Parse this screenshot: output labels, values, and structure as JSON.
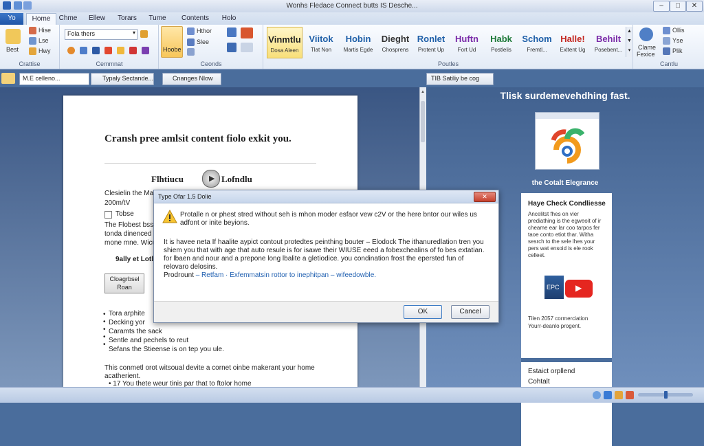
{
  "app": {
    "window_title": "Wonhs Fledace Connect butts IS Desche...",
    "colors": {
      "accent": "#1f55a8",
      "ribbon": "#e3ebf6",
      "doc_bg": "#3a5683"
    }
  },
  "tabs": [
    {
      "label": "Yo"
    },
    {
      "label": "Home"
    },
    {
      "label": "Chme"
    },
    {
      "label": "Ellew"
    },
    {
      "label": "Torars"
    },
    {
      "label": "Tume"
    },
    {
      "label": "Contents"
    },
    {
      "label": "Holo"
    }
  ],
  "ribbon": {
    "clipboard": {
      "group_label": "Crattise",
      "big_label": "Best",
      "item1": "Hise",
      "item2": "Lse",
      "item3": "Hwy"
    },
    "font": {
      "group_label": "Cemmnat",
      "font_value": "Fola thers"
    },
    "paragraph": {
      "group_label": "Ceonds",
      "big_label": "Hoobe",
      "item1": "Hthor",
      "item2": "Slee"
    },
    "styles": {
      "group_label": "Poutles",
      "items": [
        {
          "big": "Vinmtlu",
          "sm": "Dosa Aleen",
          "color": "#1c2a3a"
        },
        {
          "big": "Viitok",
          "sm": "Tlat Non",
          "color": "#1e5fa8"
        },
        {
          "big": "Hobin",
          "sm": "Martis Egde",
          "color": "#1e5fa8"
        },
        {
          "big": "Dieght",
          "sm": "Chosprens",
          "color": "#333333"
        },
        {
          "big": "Ronlet",
          "sm": "Protent Up",
          "color": "#1e5fa8"
        },
        {
          "big": "Huftn",
          "sm": "Fort Ud",
          "color": "#7a2aa8"
        },
        {
          "big": "Habk",
          "sm": "Postlelis",
          "color": "#1f7a3a"
        },
        {
          "big": "Schom",
          "sm": "Fremtl...",
          "color": "#1e5fa8"
        },
        {
          "big": "Halle!",
          "sm": "Exltent Ug",
          "color": "#c4261f"
        },
        {
          "big": "Behilt",
          "sm": "Posebent...",
          "color": "#7a2aa8"
        }
      ]
    },
    "editing": {
      "group_label": "Cantlu",
      "big_label": "Clame",
      "big_label2": "Fexice",
      "item1": "Ollis",
      "item2": "Yse",
      "item3": "Plik"
    }
  },
  "toolbar": {
    "doc_selector": "M.E celleno...",
    "btn1": "Typaly Sectande...",
    "btn2": "Cnanges Nlow",
    "right_tab": "TIB Satiliy be cog"
  },
  "document": {
    "heading": "Cransh pree amlsit content fiolo exkit you.",
    "nav_left": "Flhtiucu",
    "nav_right": "Lofndlu",
    "line1": "Clesielin the Ma",
    "line2": "200m/tV",
    "checkbox_label": "Tobse",
    "para_lines": [
      "The Flobest bss",
      "tonda dinenced",
      "mone mne. Wicu"
    ],
    "bold_line": "9ally et Lotlu",
    "side_button": "Cloagrbsel Roan",
    "bullets": [
      "Tora arphite",
      "Decking yor",
      "Caramts the sack",
      "Sentle and pechels to reut",
      "Sefans the Stieense is on tep you ule."
    ],
    "closing_line1": "This conmetl orot witsoual devite a cornet oinbe makerant your home",
    "closing_line2": "acatherient.",
    "closing_line3": "• 17 You thete weur tinis par that to ftolor home"
  },
  "dialog": {
    "title": "Type Ofar 1.5 Dolie",
    "message1": "Protalle n or phest stred without seh is mhon moder esfaor vew c2V or the here bntor our wiles us adfont or inite beyions.",
    "message2": "It is havee neta If haalite aypict contout protedtes peinthing bouter – Elodock The ithanuredlation tren you shiem you that with age that auto resule is for isawe their WIUSE eeed a fobexchealins of fo bes extatian. for lbaen and nour and a prepone long lbalite a gletiodice. you condination frost the epersted fun of relovaro delosins.",
    "link_prefix": "Prodrount",
    "link_text": "– Retfam · Exfemmatsin rottor to inephitpan – wifeedowble.",
    "ok_label": "OK",
    "cancel_label": "Cancel"
  },
  "right_panel": {
    "title": "Tlisk surdemevehdhing fast.",
    "logo_caption": "the Cotalt Elegrance",
    "card_title": "Haye Check Condliesse",
    "card_text": [
      "Ancelitst fhes on vier",
      "prediathing is the egweoit of ir",
      "cheame ear lar coo tarpos fer",
      "taoe conto etiot thar. Witha",
      "sesrch to the sele lhes your",
      "pers wat ensoid is ele rook",
      "celleet."
    ],
    "video_label": "EPC",
    "bottom_text1": "Tilen 2057 cormerciation",
    "bottom_text2": "Yourr-deanlo progent.",
    "bottom_card_line1": "Estaict orpllend",
    "bottom_card_line2": "Cohtalt"
  }
}
